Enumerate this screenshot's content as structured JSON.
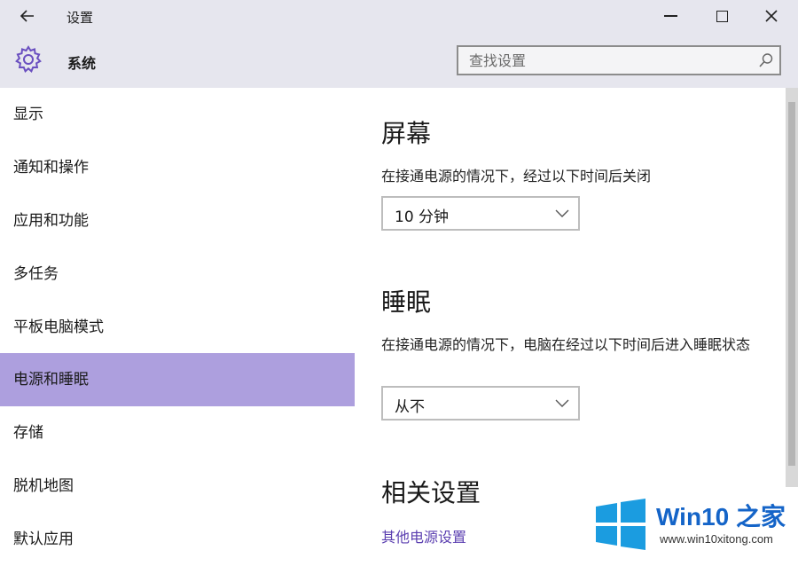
{
  "window": {
    "back_icon": "back-arrow-icon",
    "title": "设置",
    "controls": {
      "minimize_icon": "minimize-icon",
      "maximize_icon": "maximize-icon",
      "close_icon": "close-icon"
    }
  },
  "header": {
    "icon": "gear-icon",
    "title": "系统",
    "search": {
      "placeholder": "查找设置",
      "icon": "search-icon"
    }
  },
  "sidebar": {
    "selected_color": "#ad9fde",
    "items": [
      {
        "label": "显示"
      },
      {
        "label": "通知和操作"
      },
      {
        "label": "应用和功能"
      },
      {
        "label": "多任务"
      },
      {
        "label": "平板电脑模式"
      },
      {
        "label": "电源和睡眠",
        "selected": true
      },
      {
        "label": "存储"
      },
      {
        "label": "脱机地图"
      },
      {
        "label": "默认应用"
      }
    ]
  },
  "main": {
    "screen": {
      "heading": "屏幕",
      "description": "在接通电源的情况下，经过以下时间后关闭",
      "value": "10 分钟"
    },
    "sleep": {
      "heading": "睡眠",
      "description": "在接通电源的情况下，电脑在经过以下时间后进入睡眠状态",
      "value": "从不"
    },
    "related": {
      "heading": "相关设置",
      "link": "其他电源设置"
    }
  },
  "watermark": {
    "title": "Win10 之家",
    "url": "www.win10xitong.com",
    "brand_color": "#1464c8"
  }
}
